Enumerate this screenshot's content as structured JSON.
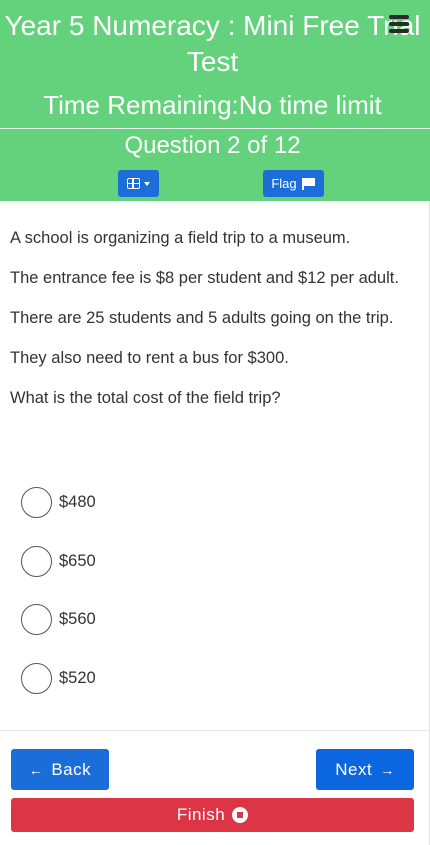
{
  "header": {
    "title": "Year 5 Numeracy : Mini Free Trial Test",
    "time_label": "Time Remaining",
    "time_sep": ":",
    "time_value": "No time limit",
    "question_counter": "Question 2 of 12",
    "flag_label": "Flag",
    "icons": {
      "menu": "hamburger-icon",
      "grid": "grid-icon",
      "flag": "flag-icon"
    }
  },
  "question": {
    "paragraphs": [
      "A school is organizing a field trip to a museum.",
      "The entrance fee is $8 per student and $12 per adult.",
      "There are 25 students and 5 adults going on the trip.",
      "They also need to rent a bus for $300.",
      "What is the total cost of the field trip?"
    ],
    "options": [
      "$480",
      "$650",
      "$560",
      "$520"
    ]
  },
  "nav": {
    "back_arrow": "←",
    "back_label": "Back",
    "next_label": "Next",
    "next_arrow": "→",
    "finish_label": "Finish"
  },
  "colors": {
    "header_bg": "#64d27c",
    "primary": "#1b6ed9",
    "danger": "#dc3545"
  }
}
